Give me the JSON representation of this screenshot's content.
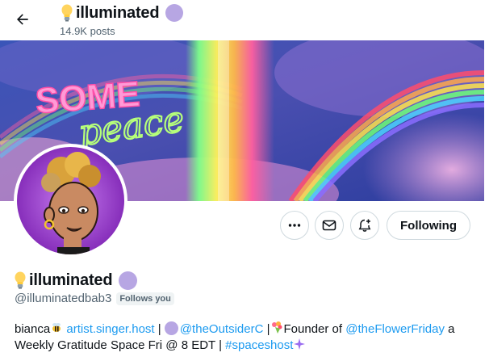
{
  "header": {
    "name": "illuminated",
    "posts": "14.9K posts"
  },
  "banner": {
    "text_line1": "SOME",
    "text_line2": "peace"
  },
  "actions": {
    "follow_label": "Following"
  },
  "profile": {
    "name": "illuminated",
    "handle": "@illuminatedbab3",
    "follows_you": "Follows you"
  },
  "bio": {
    "part1": "bianca",
    "link1": "artist.singer.host",
    "sep1": " | ",
    "mention1": "@theOutsiderC",
    "sep2": " |",
    "part2": "Founder of ",
    "mention2": "@theFlowerFriday",
    "part3": " a Weekly Gratitude Space Fri @ 8 EDT | ",
    "hashtag": "#spaceshost"
  },
  "colors": {
    "accent_link": "#1d9bf0",
    "verified_dot": "#b7a6e3",
    "muted_text": "#536471"
  },
  "icons": [
    "back-arrow-icon",
    "lightbulb-icon",
    "more-icon",
    "mail-icon",
    "notification-add-icon",
    "bee-icon",
    "bouquet-icon",
    "sparkle-icon"
  ]
}
